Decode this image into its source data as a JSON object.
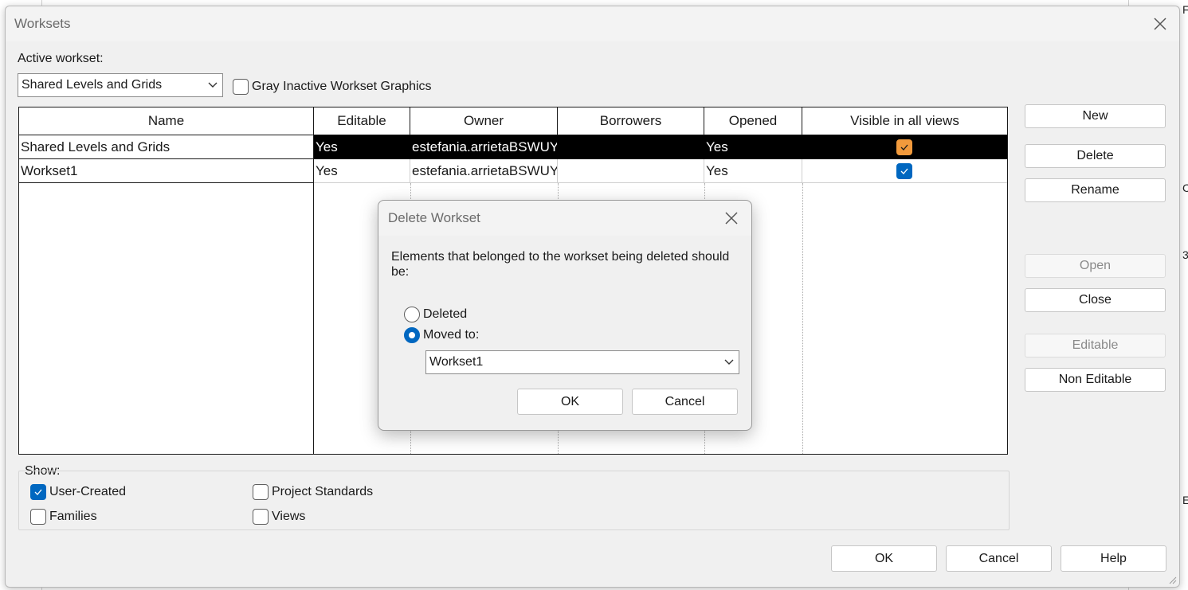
{
  "background": {
    "edge_labels": [
      "F",
      "C",
      "3",
      "E"
    ]
  },
  "dialog": {
    "title": "Worksets",
    "active_workset_label": "Active workset:",
    "active_workset_value": "Shared Levels and Grids",
    "gray_inactive_label": "Gray Inactive Workset Graphics",
    "gray_inactive_checked": false,
    "table": {
      "columns": [
        "Name",
        "Editable",
        "Owner",
        "Borrowers",
        "Opened",
        "Visible in all views"
      ],
      "rows": [
        {
          "name": "Shared Levels and Grids",
          "editable": "Yes",
          "owner": "estefania.arrietaBSWUY",
          "borrowers": "",
          "opened": "Yes",
          "visible": true,
          "selected": true
        },
        {
          "name": "Workset1",
          "editable": "Yes",
          "owner": "estefania.arrietaBSWUY",
          "borrowers": "",
          "opened": "Yes",
          "visible": true,
          "selected": false
        }
      ]
    },
    "side_buttons": {
      "new": "New",
      "delete": "Delete",
      "rename": "Rename",
      "open": "Open",
      "close": "Close",
      "editable": "Editable",
      "non_editable": "Non Editable"
    },
    "show": {
      "label": "Show:",
      "user_created": "User-Created",
      "families": "Families",
      "project_standards": "Project Standards",
      "views": "Views",
      "user_created_checked": true
    },
    "footer": {
      "ok": "OK",
      "cancel": "Cancel",
      "help": "Help"
    }
  },
  "modal": {
    "title": "Delete Workset",
    "message": "Elements that belonged to the workset being deleted should be:",
    "option_deleted": "Deleted",
    "option_moved": "Moved to:",
    "selected_option": "moved",
    "moved_to_value": "Workset1",
    "ok": "OK",
    "cancel": "Cancel"
  },
  "colors": {
    "accent": "#0067c0",
    "visible_selected": "#f29a3c",
    "selection_row": "#000000"
  }
}
